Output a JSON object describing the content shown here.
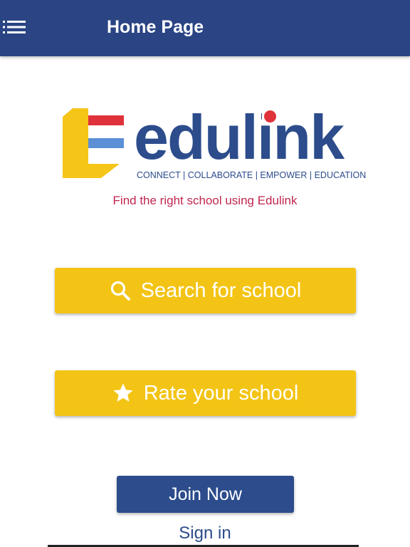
{
  "app_bar": {
    "title": "Home Page",
    "menu_icon": "hamburger-menu-icon",
    "background_color": "#2a4484"
  },
  "logo": {
    "wordmark": "edulink",
    "tagline": "CONNECT | COLLABORATE | EMPOWER | EDUCATION",
    "colors": {
      "yellow": "#f5c518",
      "red": "#e0323a",
      "blue": "#5b8fd6",
      "navy": "#2c4c8c"
    }
  },
  "subtitle": "Find the right school using Edulink",
  "buttons": {
    "search": {
      "label": "Search for school",
      "icon": "search-icon"
    },
    "rate": {
      "label": "Rate your school",
      "icon": "star-icon"
    },
    "join": {
      "label": "Join Now"
    }
  },
  "sign_in": {
    "label": "Sign in"
  },
  "colors": {
    "accent_yellow": "#f3c415",
    "primary_navy": "#2c4c8c",
    "subtitle_red": "#c0264f"
  }
}
